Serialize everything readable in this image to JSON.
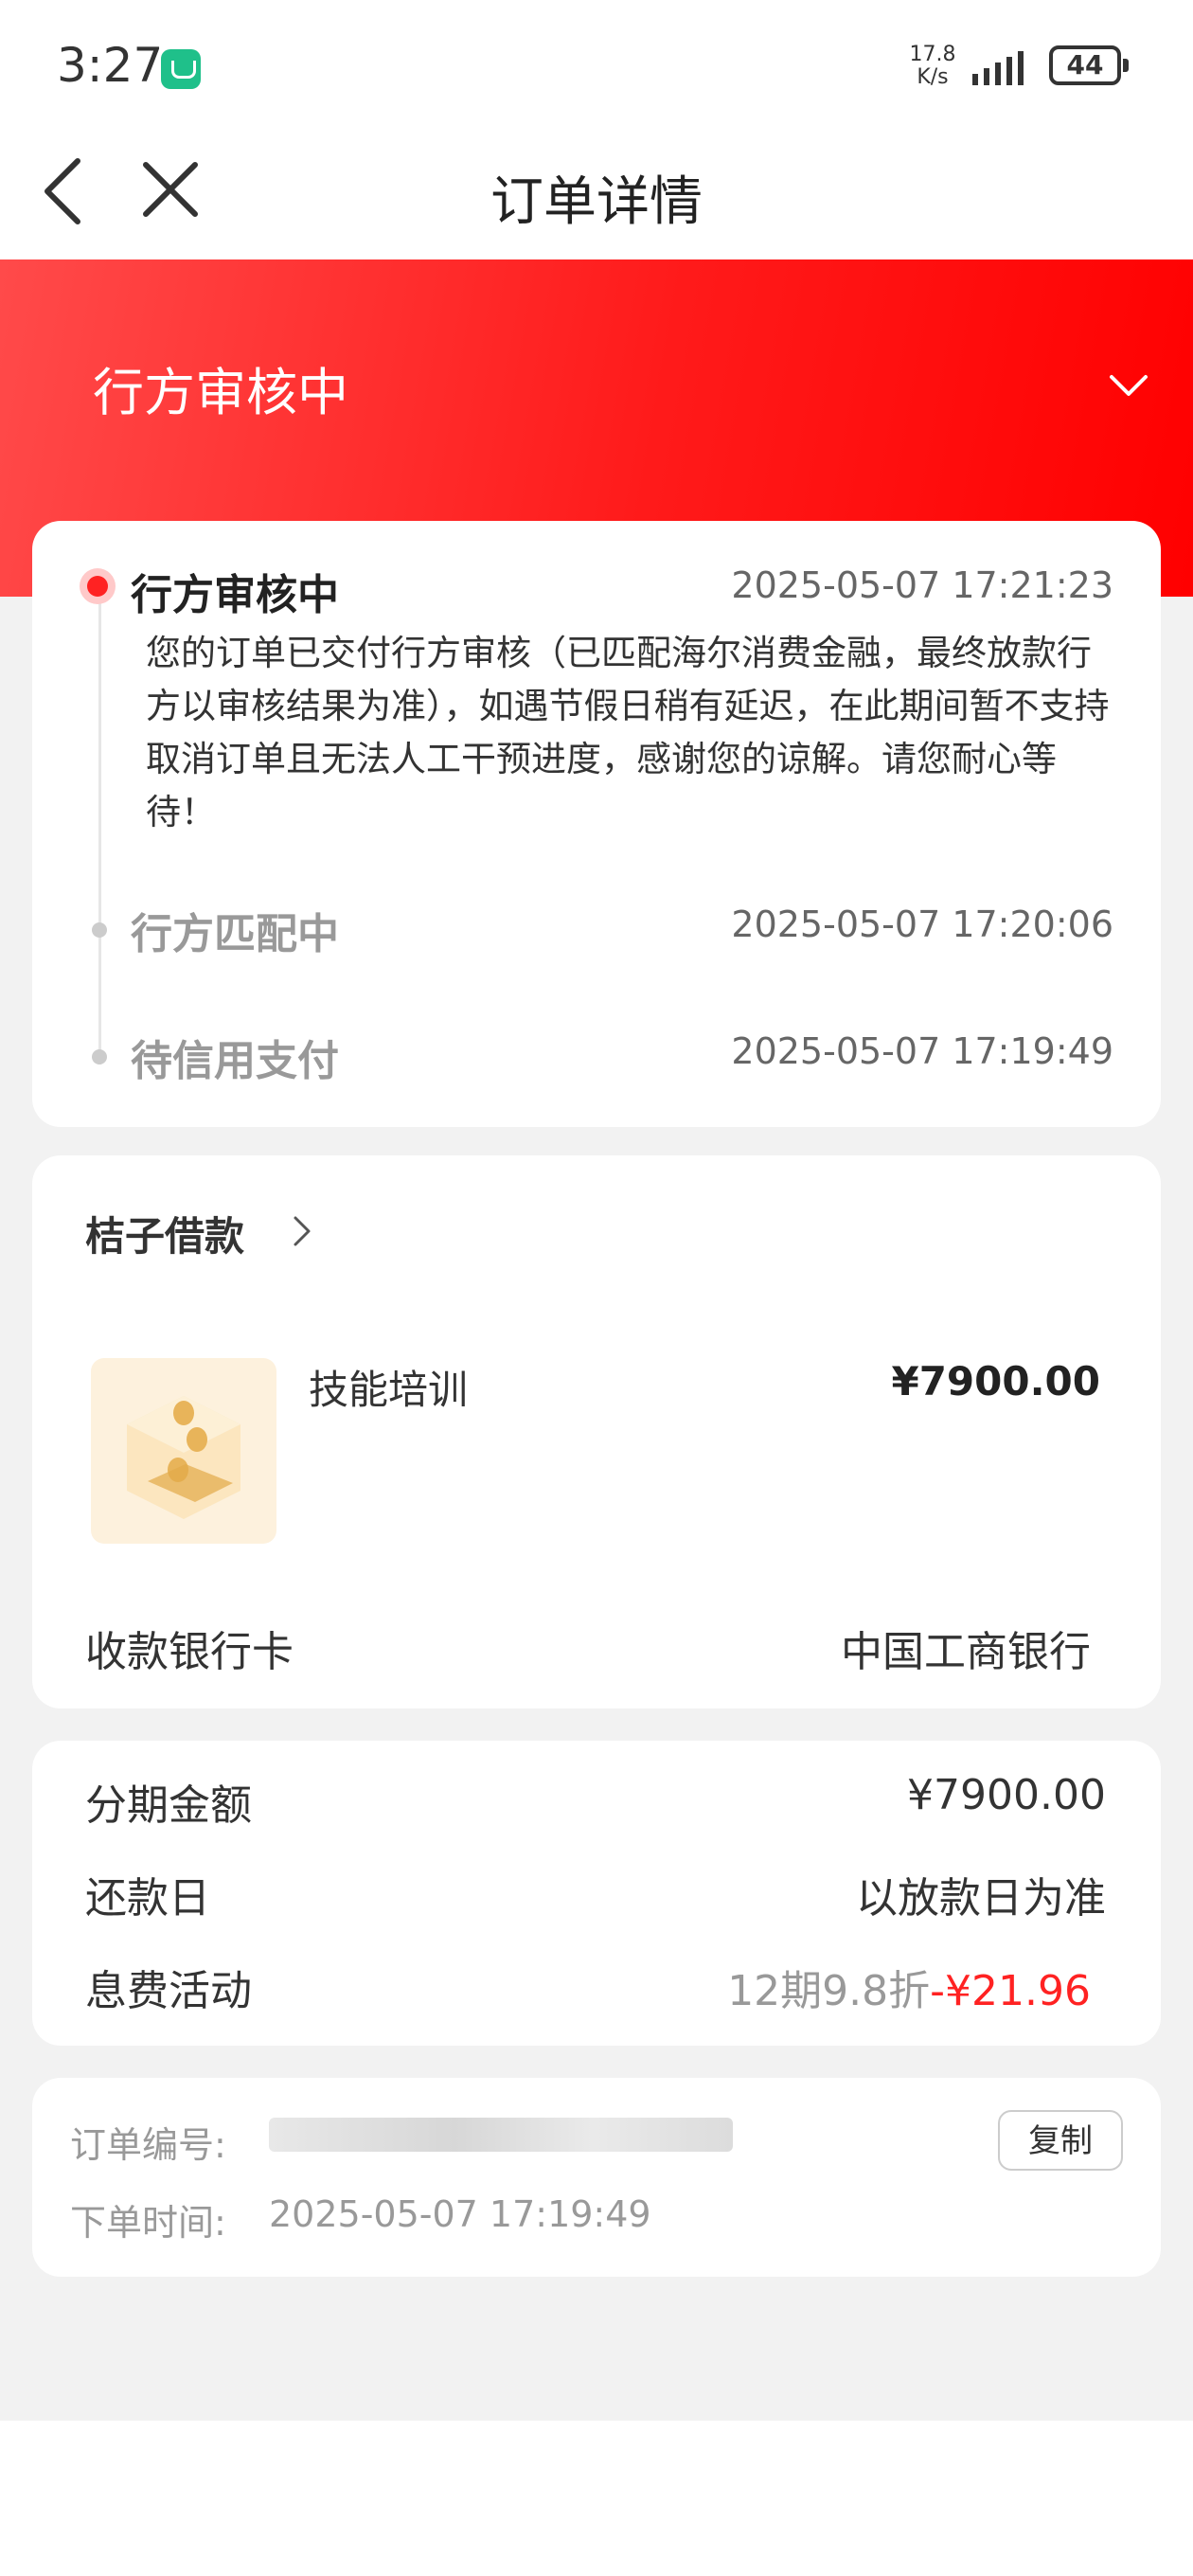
{
  "status_bar": {
    "time": "3:27",
    "speed_value": "17.8",
    "speed_unit": "K/s",
    "battery": "44"
  },
  "nav": {
    "title": "订单详情",
    "back_icon": "back-arrow-icon",
    "close_icon": "close-icon"
  },
  "banner": {
    "status": "行方审核中",
    "chevron_icon": "chevron-down-icon"
  },
  "timeline": [
    {
      "title": "行方审核中",
      "time": "2025-05-07 17:21:23",
      "desc": "您的订单已交付行方审核（已匹配海尔消费金融，最终放款行方以审核结果为准），如遇节假日稍有延迟，在此期间暂不支持取消订单且无法人工干预进度，感谢您的谅解。请您耐心等待！"
    },
    {
      "title": "行方匹配中",
      "time": "2025-05-07 17:20:06"
    },
    {
      "title": "待信用支付",
      "time": "2025-05-07 17:19:49"
    }
  ],
  "product": {
    "merchant": "桔子借款",
    "name": "技能培训",
    "price": "¥7900.00",
    "bank_label": "收款银行卡",
    "bank_value": "中国工商银行"
  },
  "info": {
    "amount_label": "分期金额",
    "amount_value": "¥7900.00",
    "repay_label": "还款日",
    "repay_value": "以放款日为准",
    "fee_label": "息费活动",
    "fee_promo": "12期9.8折",
    "fee_discount": "-¥21.96"
  },
  "order": {
    "number_label": "订单编号:",
    "time_label": "下单时间:",
    "time_value": "2025-05-07 17:19:49",
    "copy_label": "复制"
  },
  "colors": {
    "accent": "#ff2222",
    "banner_start": "#ff4a4a",
    "banner_end": "#ff0000"
  }
}
